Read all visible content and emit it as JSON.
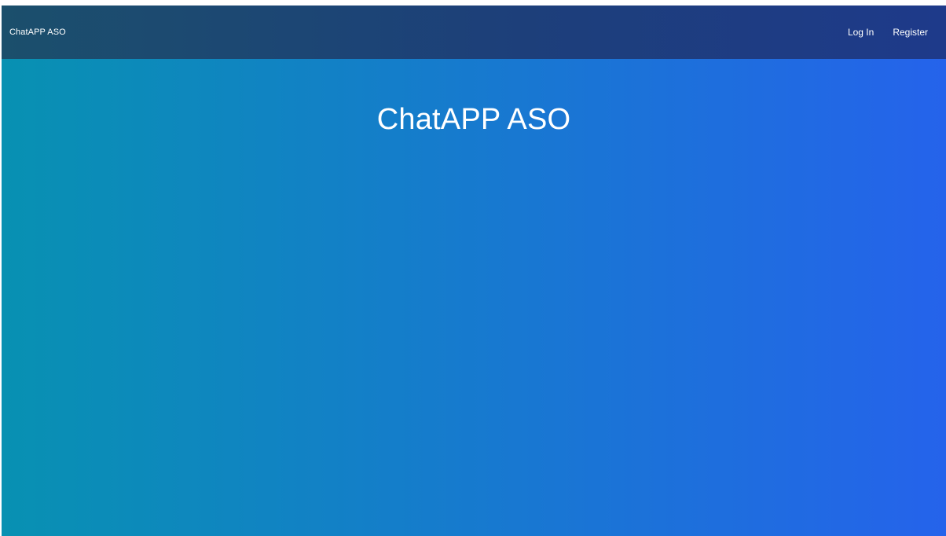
{
  "navbar": {
    "brand": "ChatAPP ASO",
    "links": [
      {
        "label": "Log In"
      },
      {
        "label": "Register"
      }
    ]
  },
  "hero": {
    "title": "ChatAPP ASO"
  },
  "colors": {
    "navbar_start": "#1b4f6c",
    "navbar_end": "#1e3a8a",
    "hero_start": "#0891b2",
    "hero_end": "#2563eb",
    "text": "#ffffff"
  }
}
